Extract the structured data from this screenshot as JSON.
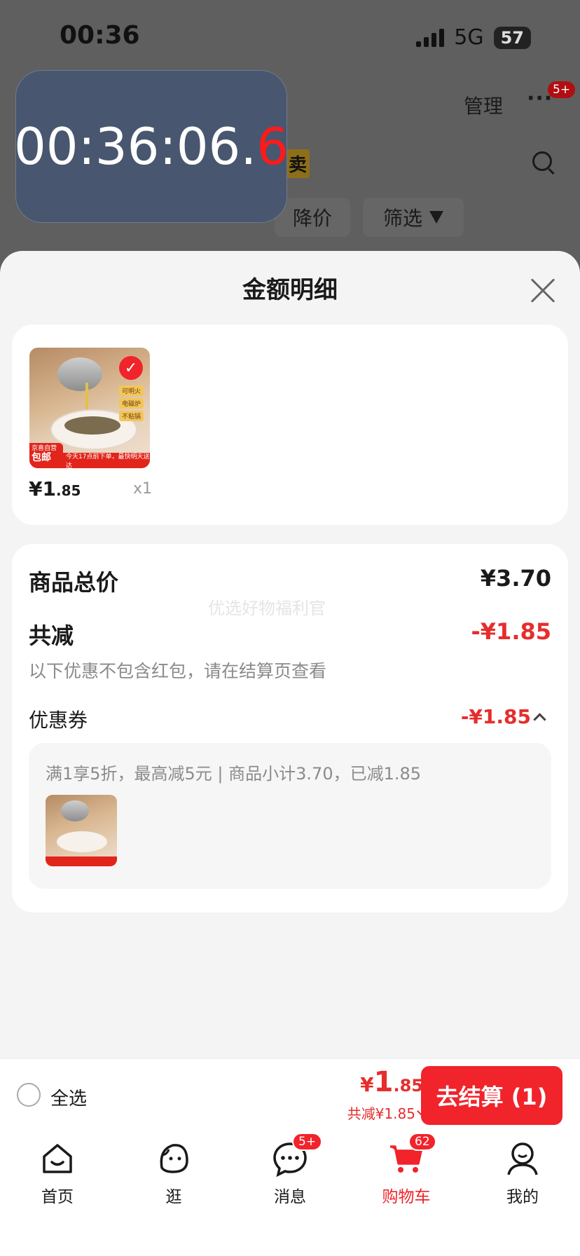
{
  "status_bar": {
    "time": "00:36",
    "network": "5G",
    "battery": "57"
  },
  "background": {
    "manage": "管理",
    "more": "···",
    "more_badge": "5+",
    "sell_tag": "卖",
    "chips": {
      "price_drop": "降价",
      "filter": "筛选"
    }
  },
  "timer_overlay": {
    "main": "00:36:06.",
    "highlight": "6"
  },
  "sheet": {
    "title": "金额明细",
    "product": {
      "price_int": "¥1",
      "price_dec": ".85",
      "qty": "x1",
      "image_tags": [
        "可明火",
        "电磁炉",
        "不粘锅"
      ],
      "image_badge_top": "京喜自营",
      "image_badge_bottom": "包邮",
      "image_bar_text": "今天17点前下单，最快明天送达"
    },
    "summary": {
      "total_label": "商品总价",
      "total_value": "¥3.70",
      "discount_label": "共减",
      "discount_value": "-¥1.85",
      "note": "以下优惠不包含红包，请在结算页查看",
      "watermark": "优选好物福利官",
      "coupon_label": "优惠券",
      "coupon_value": "-¥1.85",
      "coupon_desc": "满1享5折，最高减5元 | 商品小计3.70，已减1.85"
    }
  },
  "checkout": {
    "select_all": "全选",
    "total_symbol": "¥",
    "total_int": "1",
    "total_dec": ".85",
    "total_discount": "共减¥1.85",
    "button": "去结算 (1)"
  },
  "tabs": [
    {
      "label": "首页",
      "icon": "home-icon"
    },
    {
      "label": "逛",
      "icon": "face-icon"
    },
    {
      "label": "消息",
      "icon": "message-icon",
      "badge": "5+"
    },
    {
      "label": "购物车",
      "icon": "cart-icon",
      "badge": "62",
      "active": true
    },
    {
      "label": "我的",
      "icon": "profile-icon"
    }
  ],
  "colors": {
    "accent": "#f1232b",
    "discount_red": "#e62d2d",
    "overlay": "#485670"
  }
}
